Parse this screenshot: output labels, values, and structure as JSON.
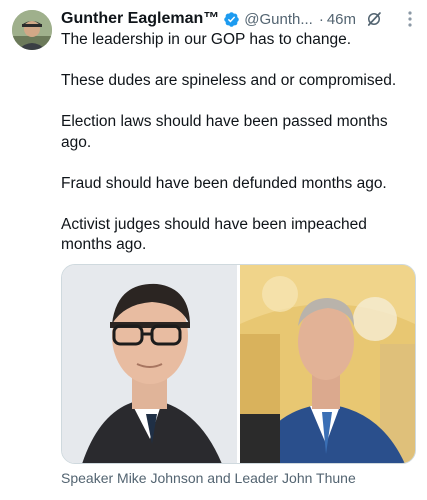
{
  "author": {
    "name": "Gunther Eagleman™",
    "handle": "@Gunth...",
    "time": "46m",
    "avatar": "profile-photo"
  },
  "icons": {
    "verified": "verified-badge-icon",
    "grok": "grok-icon",
    "more": "more-options-icon"
  },
  "tweet": {
    "paragraphs": [
      "The leadership in our GOP has to change.",
      "These dudes are spineless and or compromised.",
      "Election laws should have been passed months ago.",
      "Fraud should have been defunded months ago.",
      "Activist judges should have been impeached months ago."
    ]
  },
  "media": {
    "caption": "Speaker Mike Johnson and Leader John Thune"
  },
  "colors": {
    "verified_blue": "#1d9bf0",
    "text": "#0f1419",
    "muted": "#536471"
  }
}
